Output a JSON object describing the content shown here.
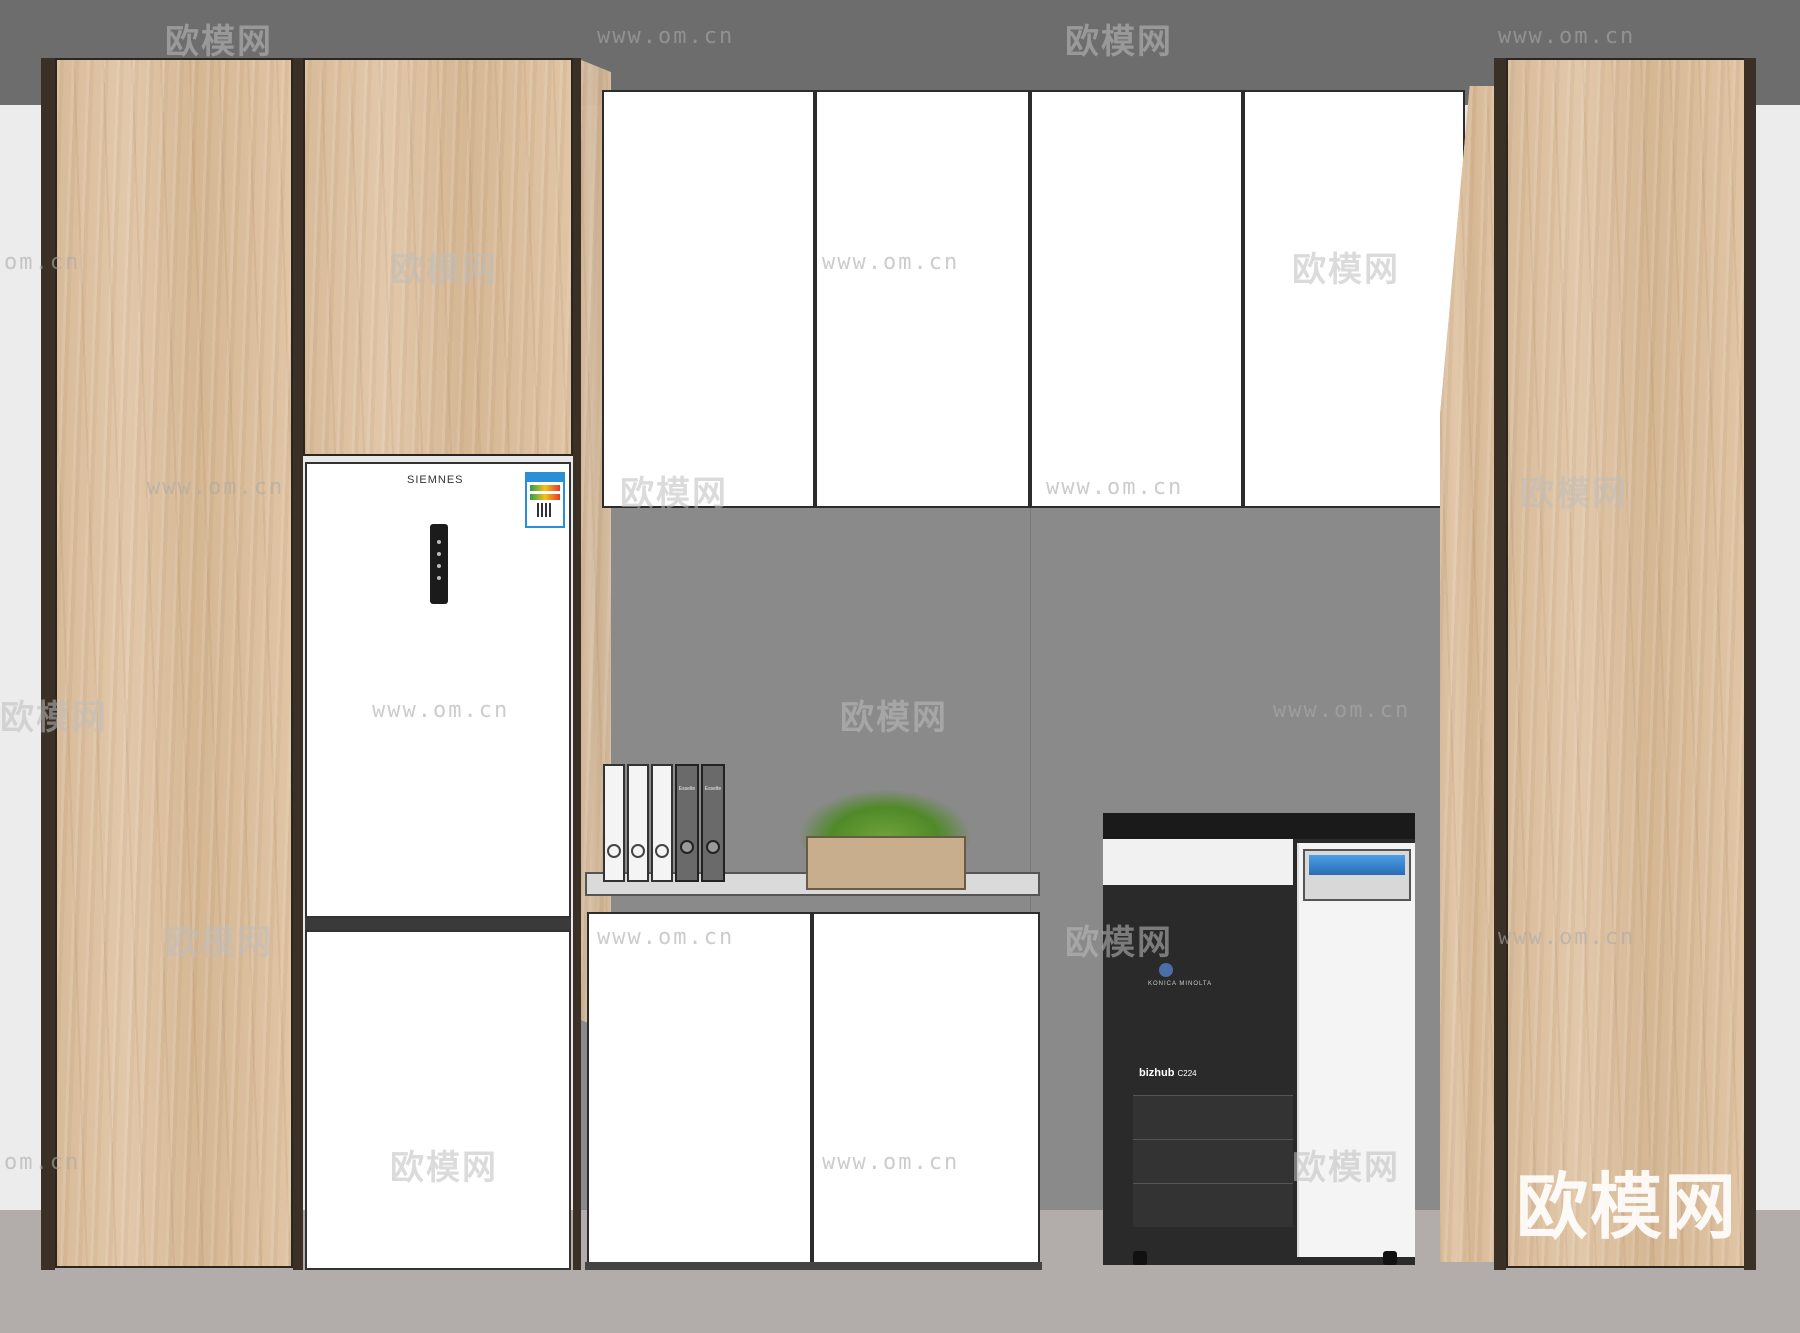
{
  "fridge": {
    "brand": "SIEMNES"
  },
  "printer": {
    "model_name": "bizhub",
    "model_number": "C224",
    "maker": "KONICA MINOLTA"
  },
  "binders": [
    "Esselte",
    "Esselte"
  ],
  "watermark": {
    "logo_text": "欧模网",
    "url": "www.om.cn",
    "url_partial": "om.cn",
    "corner_logo": "欧模网"
  },
  "colors": {
    "wall": "#8a8a8a",
    "ceiling": "#6e6e6e",
    "floor": "#b3adac",
    "wood": "#dcc0a0",
    "door": "#ffffff"
  }
}
